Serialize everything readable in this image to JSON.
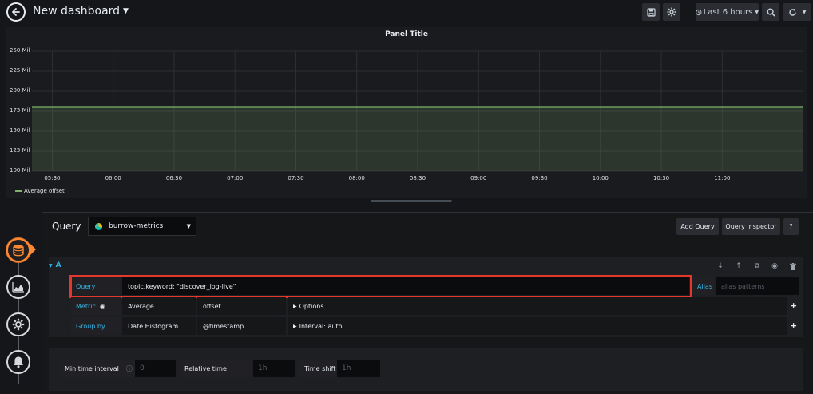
{
  "navbar": {
    "title": "New dashboard",
    "time_range": "Last 6 hours"
  },
  "panel": {
    "title": "Panel Title",
    "resize_handle": "panel-resize"
  },
  "chart_data": {
    "type": "area",
    "title": "Panel Title",
    "y_ticks": [
      "250 Mil",
      "225 Mil",
      "200 Mil",
      "175 Mil",
      "150 Mil",
      "125 Mil",
      "100 Mil"
    ],
    "x_ticks": [
      "05:30",
      "06:00",
      "06:30",
      "07:00",
      "07:30",
      "08:00",
      "08:30",
      "09:00",
      "09:30",
      "10:00",
      "10:30",
      "11:00"
    ],
    "ylim": [
      100,
      250
    ],
    "grid": true,
    "legend_placement": "bottom-left",
    "series": [
      {
        "name": "Average offset",
        "color": "#7eb26d",
        "x": [
          "05:20",
          "11:40"
        ],
        "values": [
          180,
          180
        ]
      }
    ]
  },
  "editor": {
    "query_label": "Query",
    "datasource": "burrow-metrics",
    "buttons": {
      "add_query": "Add Query",
      "query_inspector": "Query Inspector",
      "help": "?"
    },
    "query_row": {
      "ref_id": "A",
      "query_label": "Query",
      "query_value": "topic.keyword: \"discover_log-live\"",
      "alias_label": "Alias",
      "alias_placeholder": "alias patterns",
      "metric_label": "Metric",
      "metric_type": "Average",
      "metric_field": "offset",
      "metric_options": "Options",
      "groupby_label": "Group by",
      "groupby_type": "Date Histogram",
      "groupby_field": "@timestamp",
      "groupby_interval": "Interval: auto"
    },
    "options": {
      "min_interval_label": "Min time interval",
      "min_interval_placeholder": "0",
      "relative_time_label": "Relative time",
      "relative_time_placeholder": "1h",
      "time_shift_label": "Time shift",
      "time_shift_placeholder": "1h"
    }
  },
  "icons": {
    "back": "arrow-left-icon",
    "save": "save-icon",
    "settings": "gear-icon",
    "clock": "clock-icon",
    "zoom": "search-icon",
    "refresh": "refresh-icon",
    "queries": "database-icon",
    "visualization": "chart-icon",
    "general": "gear-icon",
    "alert": "bell-icon"
  },
  "colors": {
    "accent": "#33b5e5",
    "active_rail": "#ff8833",
    "series": "#7eb26d",
    "highlight_box": "#e3382b"
  }
}
